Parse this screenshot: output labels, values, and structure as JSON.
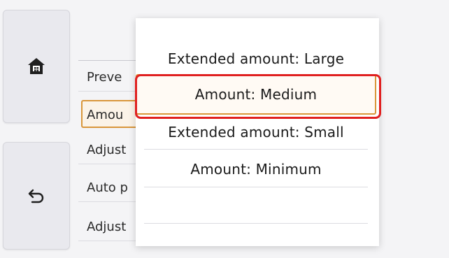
{
  "side": {
    "home_icon": "home-icon",
    "back_icon": "back-arrow-icon"
  },
  "background_list": {
    "items": [
      {
        "label": "Preve"
      },
      {
        "label": "Amou"
      },
      {
        "label": "Adjust"
      },
      {
        "label": "Auto p"
      },
      {
        "label": "Adjust"
      }
    ]
  },
  "popup": {
    "options": [
      {
        "label": "Extended amount: Large"
      },
      {
        "label": "Amount: Medium"
      },
      {
        "label": "Extended amount: Small"
      },
      {
        "label": "Amount: Minimum"
      }
    ],
    "selected_index": 1
  },
  "colors": {
    "highlight": "#e02020",
    "selection": "#d9963a"
  }
}
